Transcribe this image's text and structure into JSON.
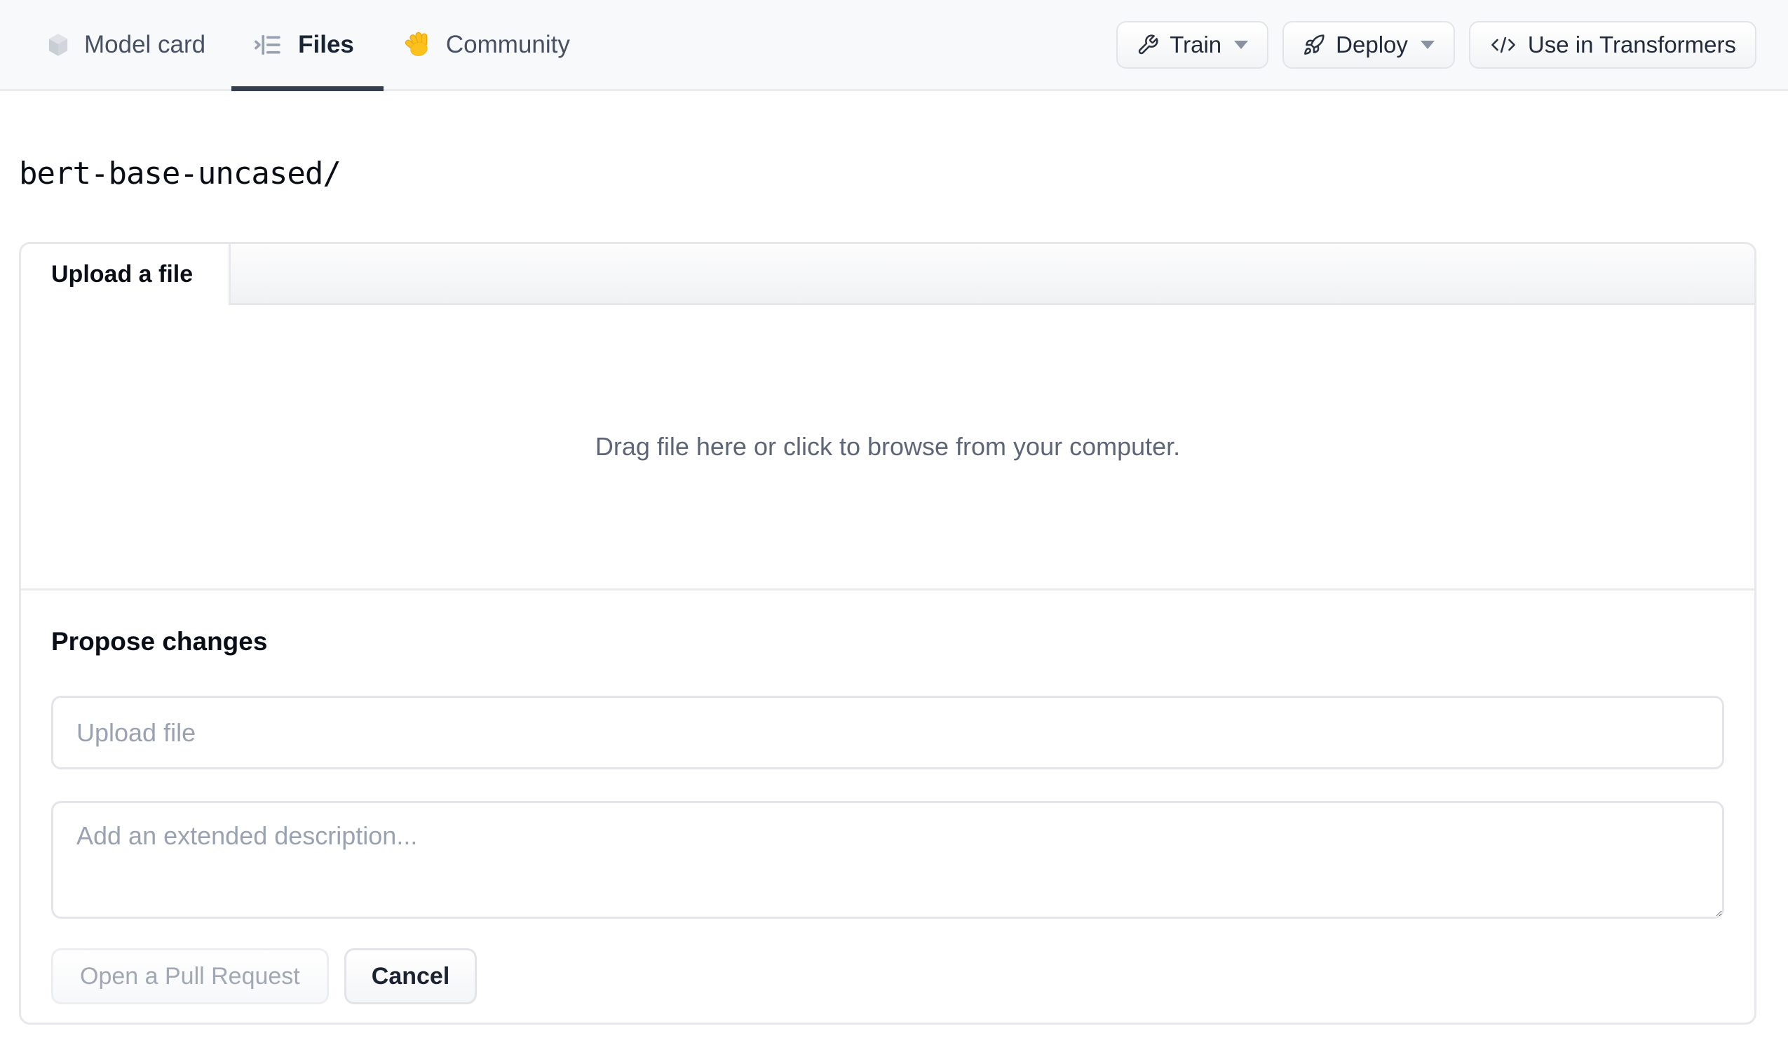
{
  "nav": {
    "tabs": [
      {
        "label": "Model card",
        "icon": "cube-icon",
        "active": false
      },
      {
        "label": "Files",
        "icon": "list-tree-icon",
        "active": true
      },
      {
        "label": "Community",
        "icon": "waving-hand-icon",
        "active": false
      }
    ],
    "actions": [
      {
        "label": "Train",
        "icon": "wrench-icon",
        "has_dropdown": true
      },
      {
        "label": "Deploy",
        "icon": "rocket-icon",
        "has_dropdown": true
      },
      {
        "label": "Use in Transformers",
        "icon": "code-icon",
        "has_dropdown": false
      }
    ]
  },
  "breadcrumb": {
    "path": "bert-base-uncased/"
  },
  "upload_panel": {
    "tab_label": "Upload a file",
    "dropzone_hint": "Drag file here or click to browse from your computer."
  },
  "propose_changes": {
    "heading": "Propose changes",
    "filename_placeholder": "Upload file",
    "description_placeholder": "Add an extended description...",
    "submit_label": "Open a Pull Request",
    "cancel_label": "Cancel"
  },
  "colors": {
    "nav_background": "#f8f9fb",
    "active_tab_underline": "#333e4f",
    "active_tab_text": "#1b2433",
    "inactive_tab_text": "#475063",
    "dropzone_text": "#5d6577",
    "placeholder_text": "#9aa2b1",
    "disabled_button_text": "#a1a8b3",
    "border": "#e6e8ec"
  }
}
